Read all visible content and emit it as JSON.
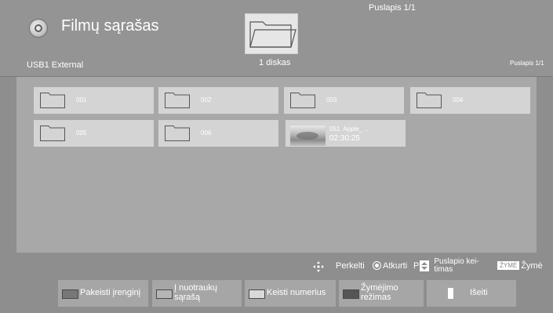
{
  "header": {
    "title": "Filmų sąrašas",
    "page_top": "Puslapis 1/1",
    "disk_count": "1 diskas",
    "source": "USB1 External",
    "page_right": "Puslapis 1/1",
    "app_icon": "film-reel-icon",
    "folder_icon": "folder-icon"
  },
  "items": [
    {
      "type": "folder",
      "label": "001"
    },
    {
      "type": "folder",
      "label": "002"
    },
    {
      "type": "folder",
      "label": "003"
    },
    {
      "type": "folder",
      "label": "004"
    },
    {
      "type": "folder",
      "label": "005"
    },
    {
      "type": "folder",
      "label": "006"
    },
    {
      "type": "video",
      "name": "051. Apple_ ...",
      "duration": "02:30:25"
    }
  ],
  "hints": {
    "move": "Perkelti",
    "play": "Atkurti",
    "page_prefix": "P",
    "page_change": "Puslapio kei-\ntimas",
    "mark_key": "ŽYMĖ",
    "mark": "Žymė"
  },
  "buttons": {
    "change_device": {
      "label": "Pakeisti įrenginį",
      "color": "#777777"
    },
    "to_photos": {
      "label": "Į nuotraukų\nsąrašą",
      "color": "#b5b5b5"
    },
    "change_numbers": {
      "label": "Keisti numerius",
      "color": "#d9d9d9"
    },
    "mark_mode": {
      "label": "Žymėjimo\nrežimas",
      "color": "#555555"
    },
    "exit": {
      "label": "Išeiti"
    }
  },
  "colors": {
    "background": "#8e8e8e",
    "content": "#a8a8a8",
    "tile": "#d4d4d4"
  }
}
